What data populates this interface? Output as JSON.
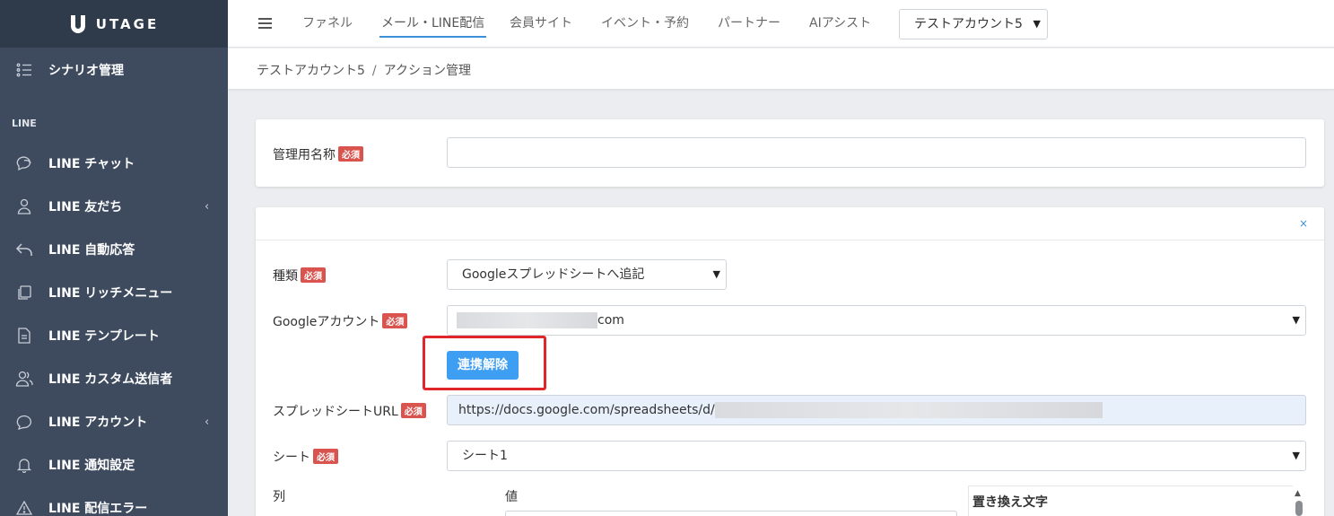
{
  "brand": {
    "name": "UTAGE"
  },
  "sidebar": {
    "items": [
      {
        "label": "シナリオ管理",
        "icon": "list-icon"
      },
      {
        "label": "LINE チャット",
        "icon": "chat-icon"
      },
      {
        "label": "LINE 友だち",
        "icon": "user-icon",
        "expandable": true
      },
      {
        "label": "LINE 自動応答",
        "icon": "reply-icon"
      },
      {
        "label": "LINE リッチメニュー",
        "icon": "copy-icon"
      },
      {
        "label": "LINE テンプレート",
        "icon": "document-icon"
      },
      {
        "label": "LINE カスタム送信者",
        "icon": "users-icon"
      },
      {
        "label": "LINE アカウント",
        "icon": "speech-icon",
        "expandable": true
      },
      {
        "label": "LINE 通知設定",
        "icon": "bell-icon"
      },
      {
        "label": "LINE 配信エラー",
        "icon": "warning-icon"
      }
    ],
    "section_line": "LINE",
    "chevron": "‹"
  },
  "topnav": {
    "tabs": [
      {
        "label": "ファネル"
      },
      {
        "label": "メール・LINE配信",
        "active": true
      },
      {
        "label": "会員サイト"
      },
      {
        "label": "イベント・予約"
      },
      {
        "label": "パートナー"
      },
      {
        "label": "AIアシスト"
      }
    ],
    "account_select": "テストアカウント5"
  },
  "breadcrumb": {
    "items": [
      "テストアカウント5",
      "アクション管理"
    ],
    "separator": "/"
  },
  "form": {
    "required_badge": "必須",
    "name_label": "管理用名称",
    "name_value": "",
    "close_symbol": "×",
    "type_label": "種類",
    "type_value": "Googleスプレッドシートへ追記",
    "google_label": "Googleアカウント",
    "google_value_suffix": "com",
    "unlink_button": "連携解除",
    "url_label": "スプレッドシートURL",
    "url_value": "https://docs.google.com/spreadsheets/d/",
    "sheet_label": "シート",
    "sheet_value": "シート1",
    "col_label": "列",
    "value_label": "値",
    "replace_label": "置き換え文字"
  },
  "colors": {
    "sidebar_bg": "#3e4b5f",
    "accent": "#3d8fd8",
    "primary_button": "#3e9ef2",
    "required_badge": "#d9534f",
    "highlight": "#e0262b"
  }
}
